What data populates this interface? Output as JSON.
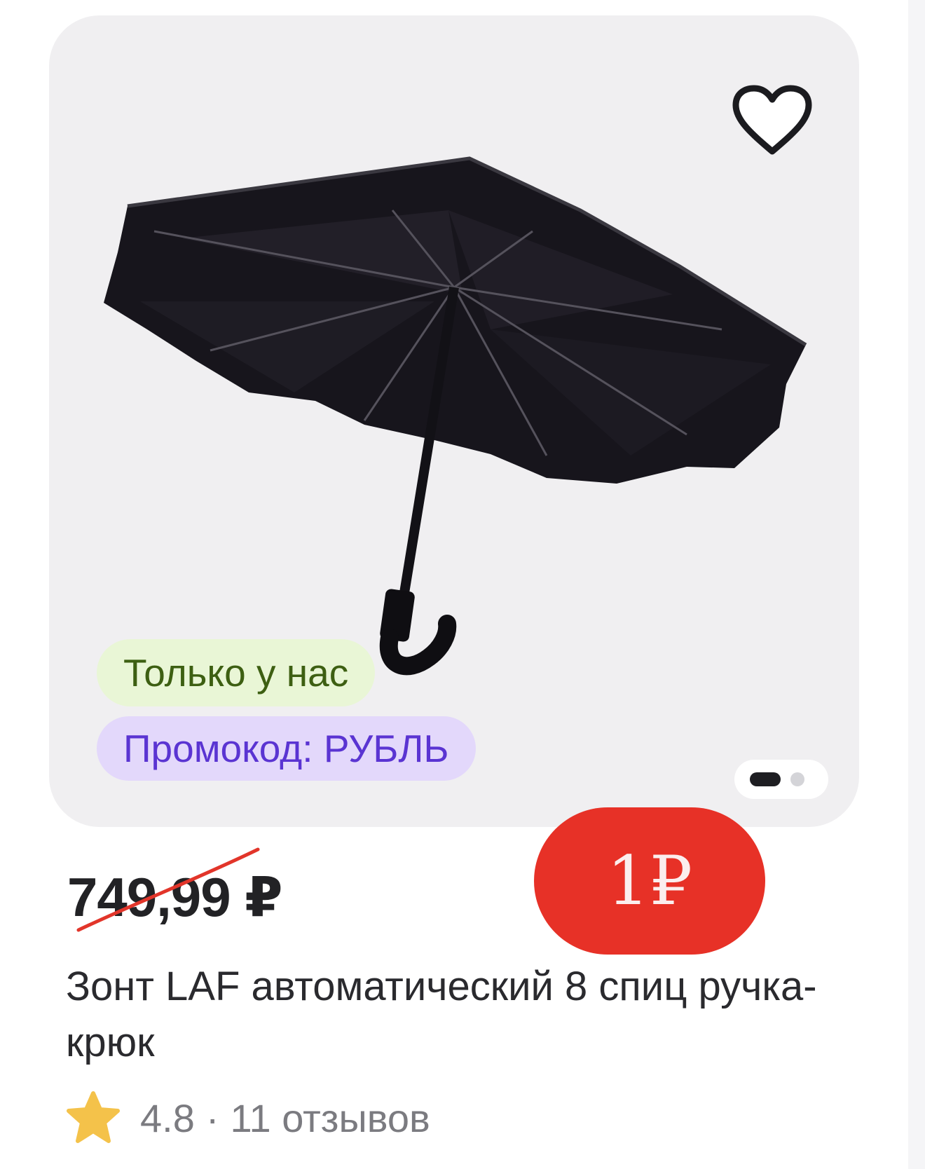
{
  "badges": {
    "exclusive": "Только у нас",
    "promo": "Промокод: РУБЛЬ"
  },
  "gallery": {
    "image_count": 2,
    "active_index": 0
  },
  "price": {
    "old": "749,99 ₽",
    "new": "1₽"
  },
  "product": {
    "title": "Зонт LAF автоматический 8 спиц ручка-крюк"
  },
  "rating": {
    "value": "4.8",
    "separator": "·",
    "reviews": "11 отзывов"
  },
  "icons": {
    "favorite": "heart-outline-icon",
    "rating": "star-icon"
  },
  "colors": {
    "new_price_bg": "#e73127",
    "exclusive_badge_bg": "#e9f6d6",
    "promo_badge_bg": "#e3d8fb",
    "promo_text": "#5a34d2",
    "star": "#f4c24a"
  }
}
